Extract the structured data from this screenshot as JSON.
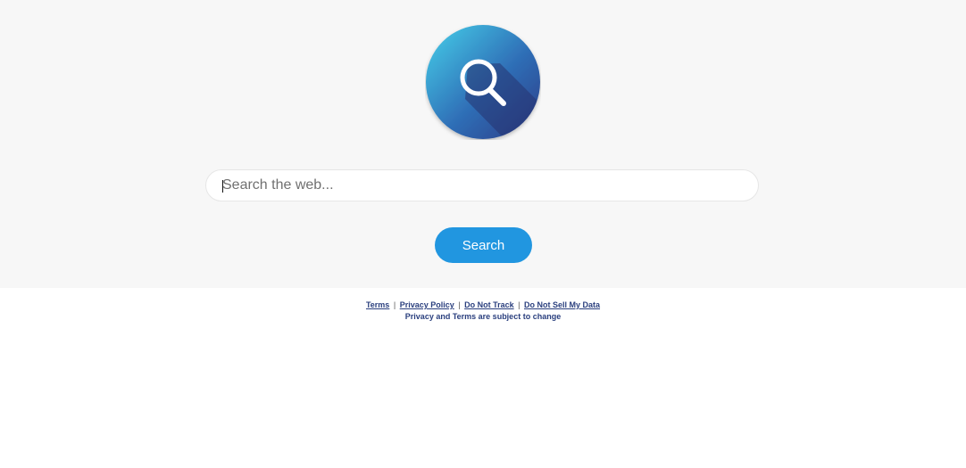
{
  "logo": {
    "icon": "magnifier-icon",
    "gradient": [
      "#3fc6e6",
      "#2b3f8a"
    ]
  },
  "search": {
    "placeholder": "Search the web...",
    "value": "",
    "button_label": "Search",
    "button_color": "#2196e0"
  },
  "footer": {
    "links": {
      "terms": "Terms",
      "privacy": "Privacy Policy",
      "do_not_track": "Do Not Track",
      "do_not_sell": "Do Not Sell My Data"
    },
    "separator": "|",
    "note": "Privacy and Terms are subject to change"
  }
}
